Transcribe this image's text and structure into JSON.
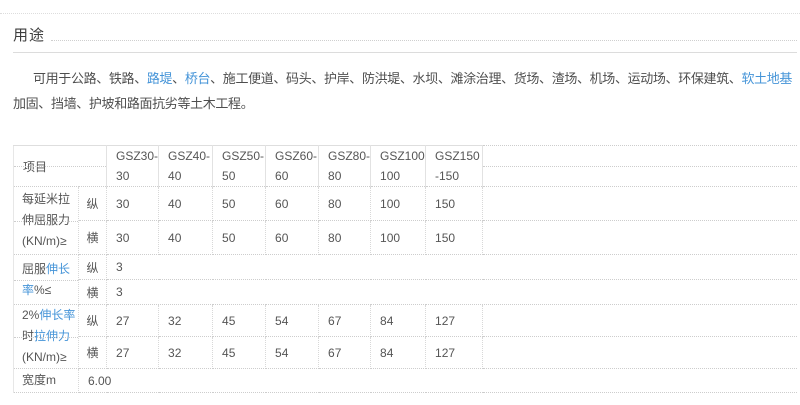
{
  "colors": {
    "link": "#4594d8"
  },
  "section": {
    "title": "用途"
  },
  "intro": {
    "parts": [
      {
        "t": "可用于公路、铁路、"
      },
      {
        "t": "路堤",
        "link": true
      },
      {
        "t": "、"
      },
      {
        "t": "桥台",
        "link": true
      },
      {
        "t": "、施工便道、码头、护岸、防洪堤、水坝、滩涂治理、货场、渣场、机场、运动场、环保建筑、"
      },
      {
        "t": "软土地基",
        "link": true
      },
      {
        "t": "加固、挡墙、护坡和路面抗劣等土木工程。"
      }
    ]
  },
  "table": {
    "header": {
      "item": "项目",
      "columns": [
        {
          "top": "GSZ30-",
          "bottom": "30"
        },
        {
          "top": "GSZ40-",
          "bottom": "40"
        },
        {
          "top": "GSZ50-",
          "bottom": "50"
        },
        {
          "top": "GSZ60-",
          "bottom": "60"
        },
        {
          "top": "GSZ80-",
          "bottom": "80"
        },
        {
          "top": "GSZ100-",
          "bottom": "100"
        },
        {
          "top": "GSZ150",
          "bottom": "-150"
        }
      ]
    },
    "groups": [
      {
        "label_lines": [
          {
            "segments": [
              {
                "t": "每延米拉"
              }
            ]
          },
          {
            "segments": [
              {
                "t": "伸屈服力"
              }
            ]
          },
          {
            "segments": [
              {
                "t": "(KN/m)≥"
              }
            ]
          }
        ],
        "rows": [
          {
            "axis": "纵",
            "values": [
              "30",
              "40",
              "50",
              "60",
              "80",
              "100",
              "150"
            ]
          },
          {
            "axis": "横",
            "values": [
              "30",
              "40",
              "50",
              "60",
              "80",
              "100",
              "150"
            ]
          }
        ]
      },
      {
        "label_lines": [
          {
            "segments": [
              {
                "t": "屈服"
              },
              {
                "t": "伸长",
                "link": true
              }
            ]
          },
          {
            "segments": [
              {
                "t": "率",
                "link": true
              },
              {
                "t": "%≤"
              }
            ]
          }
        ],
        "rows": [
          {
            "axis": "纵",
            "value": "3"
          },
          {
            "axis": "横",
            "value": "3"
          }
        ]
      },
      {
        "label_lines": [
          {
            "segments": [
              {
                "t": "2%"
              },
              {
                "t": "伸长率",
                "link": true
              }
            ]
          },
          {
            "segments": [
              {
                "t": "时"
              },
              {
                "t": "拉伸力",
                "link": true
              }
            ]
          },
          {
            "segments": [
              {
                "t": "(KN/m)≥"
              }
            ]
          }
        ],
        "rows": [
          {
            "axis": "纵",
            "values": [
              "27",
              "32",
              "45",
              "54",
              "67",
              "84",
              "127"
            ]
          },
          {
            "axis": "横",
            "values": [
              "27",
              "32",
              "45",
              "54",
              "67",
              "84",
              "127"
            ]
          }
        ]
      },
      {
        "label_lines": [
          {
            "segments": [
              {
                "t": "宽度m"
              }
            ]
          }
        ],
        "rows": [
          {
            "value": "6.00"
          }
        ]
      }
    ]
  }
}
